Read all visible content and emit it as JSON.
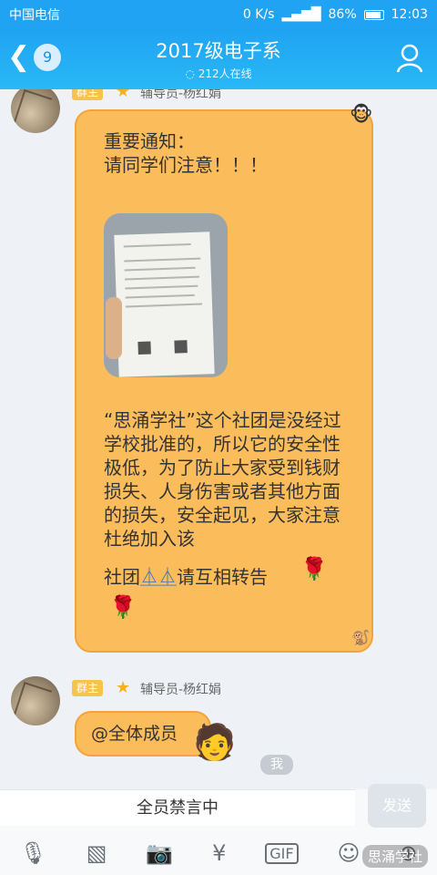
{
  "status": {
    "carrier": "中国电信",
    "speed": "0 K/s",
    "battery": "86%",
    "time": "12:03"
  },
  "header": {
    "unread": "9",
    "title": "2017级电子系",
    "online": "212人在线"
  },
  "messages": [
    {
      "role": "群主",
      "sender": "辅导员-杨红娟",
      "text": "重要通知：\n请同学们注意！！！",
      "body": "“思涌学社”这个社团是没经过学校批准的，所以它的安全性极低，为了防止大家受到钱财损失、人身伤害或者其他方面的损失，安全起见，大家注意杜绝加入该",
      "tail": "社团",
      "tail2": "请互相转告"
    },
    {
      "role": "群主",
      "sender": "辅导员-杨红娟",
      "text": "@全体成员"
    }
  ],
  "self": {
    "label": "我"
  },
  "input": {
    "placeholder": "全员禁言中",
    "send": "发送"
  },
  "watermark": "思涌学社"
}
